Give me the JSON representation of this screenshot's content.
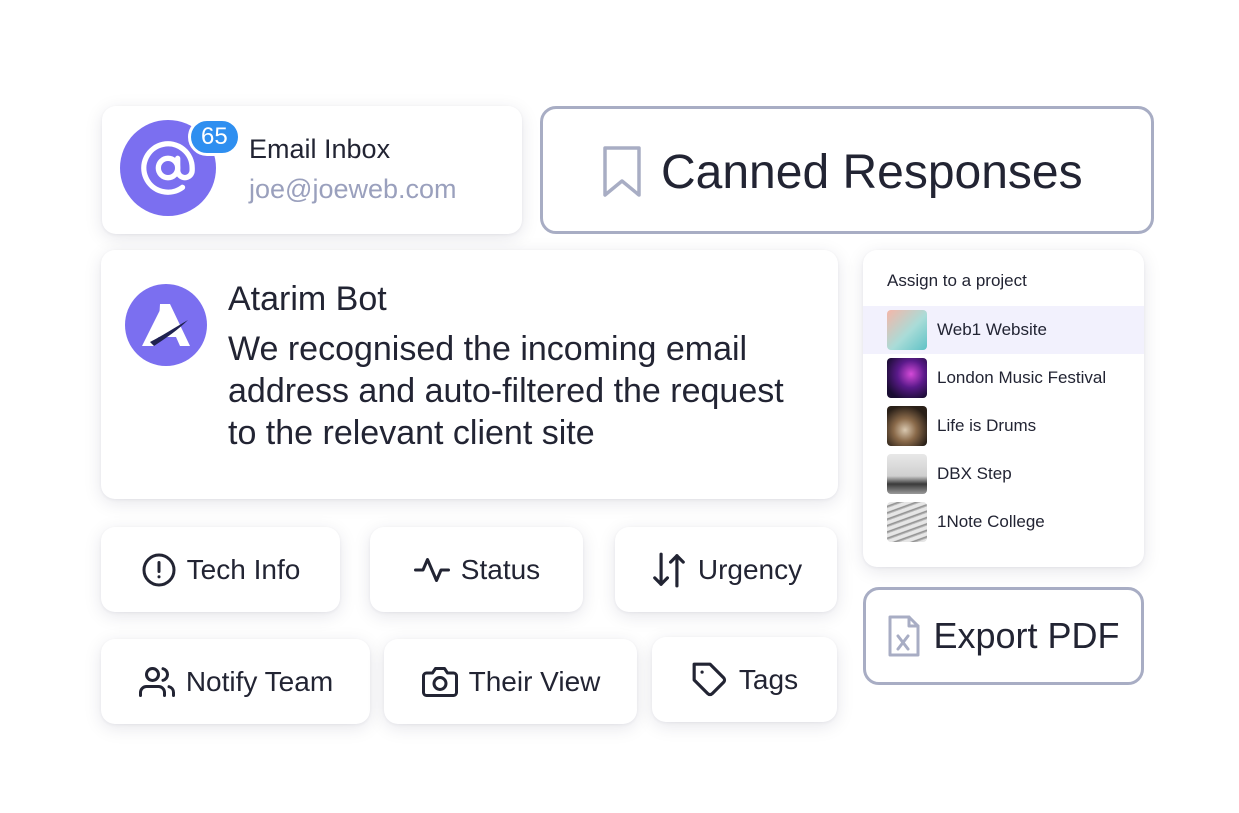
{
  "email_inbox": {
    "title": "Email Inbox",
    "address": "joe@joeweb.com",
    "badge_count": "65",
    "avatar_icon": "at-sign-icon"
  },
  "canned_responses": {
    "label": "Canned Responses",
    "icon": "bookmark-icon"
  },
  "bot": {
    "name": "Atarim Bot",
    "message": "We recognised the incoming email address and auto-filtered the request to the relevant client site",
    "avatar_icon": "atarim-logo"
  },
  "project_assign": {
    "heading": "Assign to a project",
    "projects": [
      {
        "name": "Web1 Website",
        "selected": true
      },
      {
        "name": "London Music Festival",
        "selected": false
      },
      {
        "name": "Life is Drums",
        "selected": false
      },
      {
        "name": "DBX Step",
        "selected": false
      },
      {
        "name": "1Note College",
        "selected": false
      }
    ]
  },
  "actions": {
    "tech_info": "Tech Info",
    "status": "Status",
    "urgency": "Urgency",
    "notify_team": "Notify Team",
    "their_view": "Their View",
    "tags": "Tags"
  },
  "export": {
    "label": "Export PDF",
    "icon": "file-excel-icon"
  },
  "colors": {
    "accent_purple": "#7b6ff0",
    "badge_blue": "#2f8ff0",
    "muted_text": "#9aa0bd",
    "outline": "#a8adc4",
    "selected_row": "#f2f1fd"
  }
}
